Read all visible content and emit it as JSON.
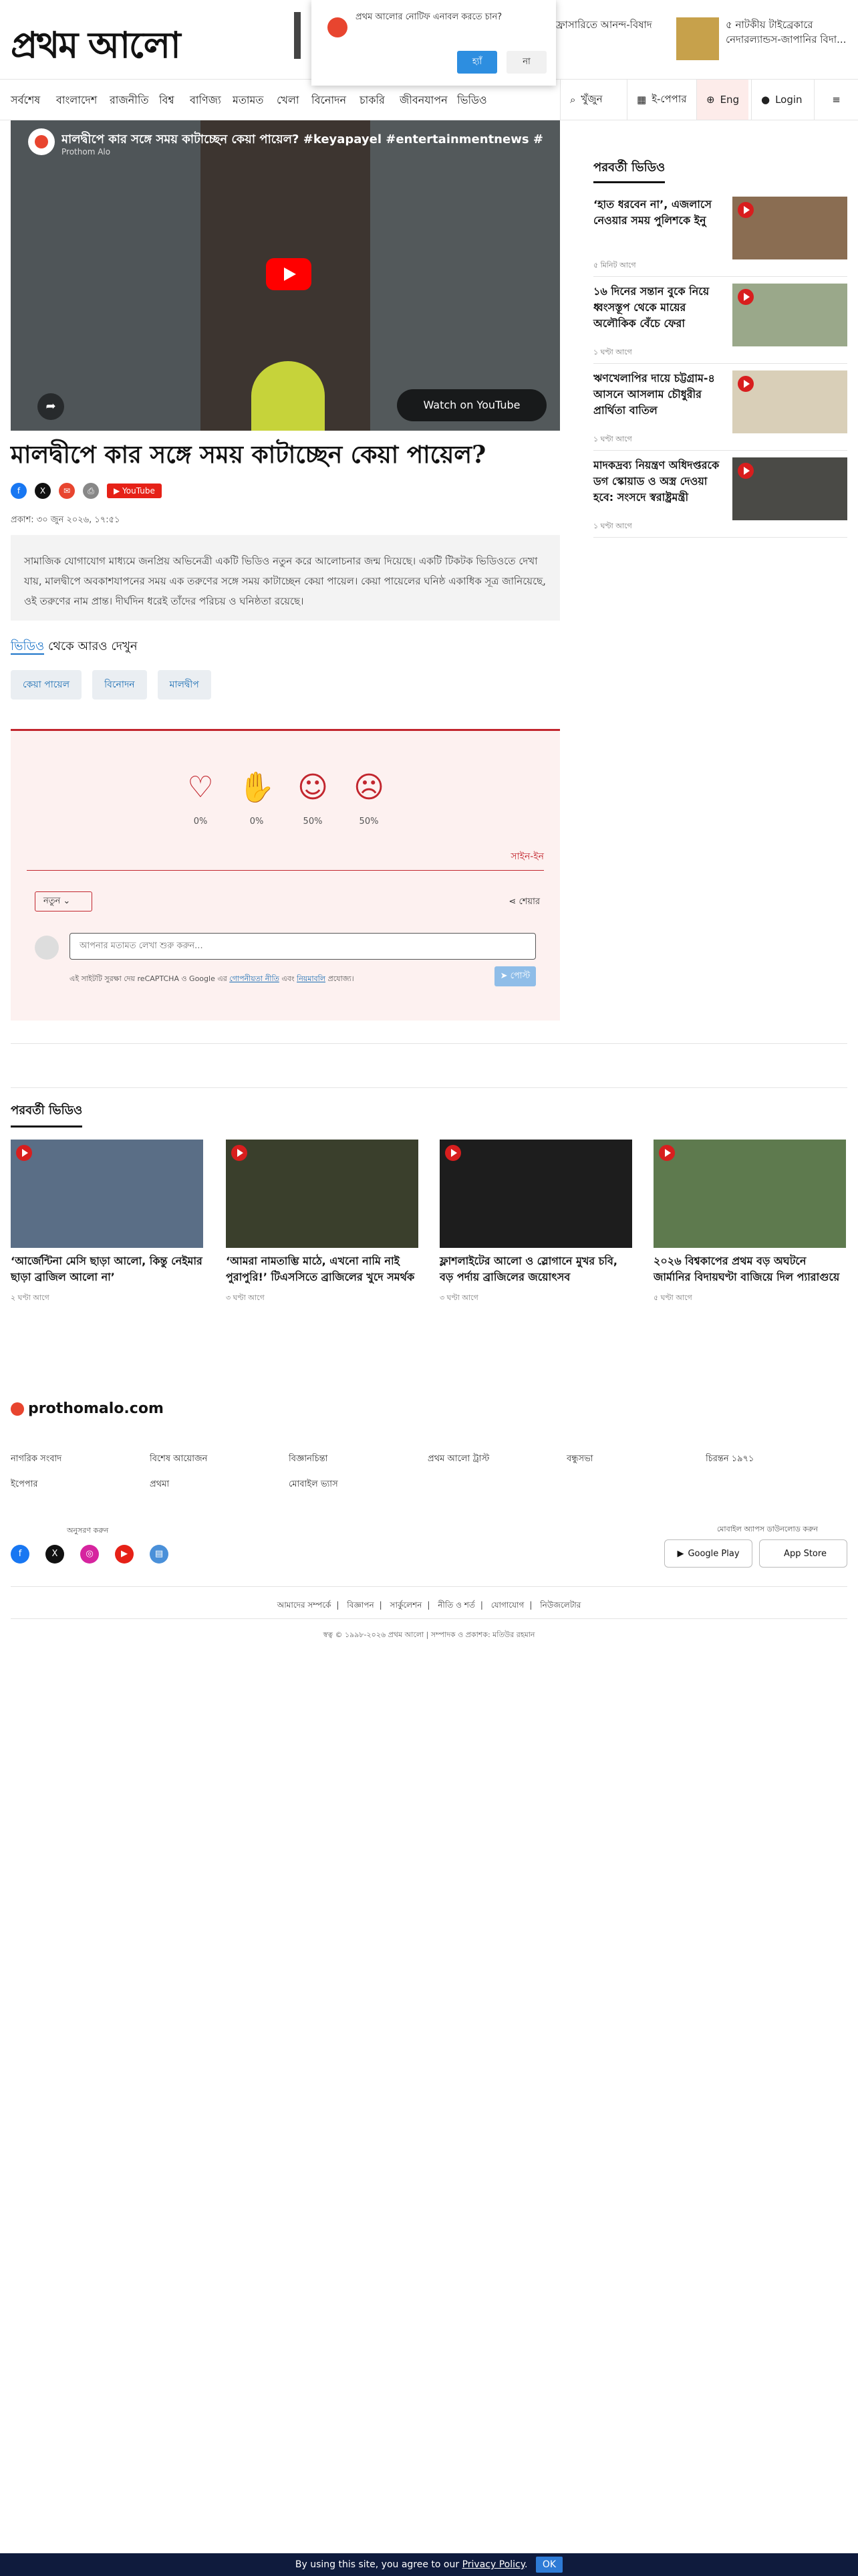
{
  "header": {
    "logo_text": "প্রথম আলো",
    "top_news_1": "ফ্রাসারিতে আনন্দ-বিষাদ",
    "top_news_2_line1": "৫ নাটকীয় টাইব্রেকারে",
    "top_news_2_line2": "নেদারল্যান্ডস-জাপানির বিদা..."
  },
  "notification": {
    "message": "প্রথম আলোর নোটিফ এনাবল করতে চান?",
    "yes": "হ্যাঁ",
    "no": "না"
  },
  "nav": {
    "items": [
      "সর্বশেষ",
      "বাংলাদেশ",
      "রাজনীতি",
      "বিশ্ব",
      "বাণিজ্য",
      "মতামত",
      "খেলা",
      "বিনোদন",
      "চাকরি",
      "জীবনযাপন",
      "ভিডিও"
    ],
    "search": "খুঁজুন",
    "epaper": "ই-পেপার",
    "lang": "Eng",
    "login": "Login"
  },
  "player": {
    "title": "মালদ্বীপে কার সঙ্গে সময় কাটাচ্ছেন কেয়া পায়েল? #keyapayel #entertainmentnews #proth",
    "channel": "Prothom Alo",
    "watch_on": "Watch on YouTube"
  },
  "article": {
    "headline": "মালদ্বীপে কার সঙ্গে সময় কাটাচ্ছেন কেয়া পায়েল?",
    "youtube_badge": "YouTube",
    "published": "প্রকাশ: ৩০ জুন ২০২৬, ১৭:৫১",
    "summary": "সামাজিক যোগাযোগ মাধ্যমে জনপ্রিয় অভিনেত্রী একটি ভিডিও নতুন করে আলোচনার জন্ম দিয়েছে। একটি টিকটক ভিডিওতে দেখা যায়, মালদ্বীপে অবকাশযাপনের সময় এক তরুণের সঙ্গে সময় কাটাচ্ছেন কেয়া পায়েল। কেয়া পায়েলের ঘনিষ্ঠ একাধিক সূত্র জানিয়েছে, ওই তরুণের নাম প্রান্ত। দীর্ঘদিন ধরেই তাঁদের পরিচয় ও ঘনিষ্ঠতা রয়েছে।",
    "more_from_prefix": "ভিডিও",
    "more_from_suffix": " থেকে আরও দেখুন",
    "tags": [
      "কেয়া পায়েল",
      "বিনোদন",
      "মালদ্বীপ"
    ]
  },
  "comments": {
    "reactions": [
      {
        "icon": "heart-icon",
        "glyph": "♡",
        "pct": "0%"
      },
      {
        "icon": "clap-icon",
        "glyph": "✋",
        "pct": "0%"
      },
      {
        "icon": "smile-icon",
        "glyph": "☺",
        "pct": "50%"
      },
      {
        "icon": "sad-icon",
        "glyph": "☹",
        "pct": "50%"
      }
    ],
    "signin": "সাইন-ইন",
    "sort": "নতুন",
    "share": "শেয়ার",
    "placeholder": "আপনার মতামত লেখা শুরু করুন...",
    "captcha_pre": "এই সাইটটি সুরক্ষা দেয় reCAPTCHA ও Google এর ",
    "privacy": "গোপনীয়তা নীতি",
    "and": " এবং ",
    "terms": "নিয়মাবলি",
    "captcha_post": " প্রযোজ্য।",
    "send": "পোস্ট"
  },
  "sidebar": {
    "heading": "পরবর্তী ভিডিও",
    "items": [
      {
        "title": "‘হাত ধরবেন না’, এজলাসে নেওয়ার সময় পুলিশকে ইনু",
        "time": "৫ মিনিট আগে",
        "color": "#8a6d52"
      },
      {
        "title": "১৬ দিনের সন্তান বুকে নিয়ে ধ্বংসস্তূপ থেকে মায়ের অলৌকিক বেঁচে ফেরা",
        "time": "১ ঘণ্টা আগে",
        "color": "#9aa88a"
      },
      {
        "title": "ঋণখেলাপির দায়ে চট্টগ্রাম-৪ আসনে আসলাম চৌধুরীর প্রার্থিতা বাতিল",
        "time": "১ ঘণ্টা আগে",
        "color": "#d9cfb8"
      },
      {
        "title": "মাদকদ্রব্য নিয়ন্ত্রণ অধিদপ্তরকে ডগ স্কোয়াড ও অস্ত্র দেওয়া হবে: সংসদে স্বরাষ্ট্রমন্ত্রী",
        "time": "১ ঘণ্টা আগে",
        "color": "#4a4a46"
      }
    ]
  },
  "next_videos": {
    "heading": "পরবর্তী ভিডিও",
    "items": [
      {
        "title": "‘আর্জেন্টিনা মেসি ছাড়া আলো, কিন্তু নেইমার ছাড়া ব্রাজিল আলো না’",
        "time": "২ ঘণ্টা আগে",
        "color": "#5a6e86"
      },
      {
        "title": "‘আমরা নামতাম্ভি মাঠে, এখনো নামি নাই পুরাপুরি!’ টিএসসিতে ব্রাজিলের খুদে সমর্থক",
        "time": "৩ ঘণ্টা আগে",
        "color": "#3a3f2c"
      },
      {
        "title": "ফ্লাশলাইটের আলো ও স্লোগানে মুখর চবি, বড় পর্দায় ব্রাজিলের জয়োৎসব",
        "time": "৩ ঘণ্টা আগে",
        "color": "#1d1d1d"
      },
      {
        "title": "২০২৬ বিশ্বকাপের প্রথম বড় অঘটনে জার্মানির বিদায়ঘণ্টা বাজিয়ে দিল প্যারাগুয়ে",
        "time": "৫ ঘণ্টা আগে",
        "color": "#5e7a4e"
      }
    ]
  },
  "footer": {
    "logo": "prothomalo.com",
    "links_row1": [
      "নাগরিক সংবাদ",
      "বিশেষ আয়োজন",
      "বিজ্ঞানচিন্তা",
      "প্রথম আলো ট্রাস্ট",
      "বন্ধুসভা",
      "চিরন্তন ১৯৭১"
    ],
    "links_row2": [
      "ইপেপার",
      "প্রথমা",
      "মোবাইল ভ্যাস"
    ],
    "follow": "অনুসরণ করুন",
    "mobile_apps": "মোবাইল অ্যাপস ডাউনলোড করুন",
    "google_play": "Google Play",
    "app_store": "App Store",
    "bottom_links": [
      "আমাদের সম্পর্কে",
      "বিজ্ঞাপন",
      "সার্কুলেশন",
      "নীতি ও শর্ত",
      "যোগাযোগ",
      "নিউজলেটার"
    ],
    "copyright": "স্বত্ব © ১৯৯৮-২০২৬ প্রথম আলো  |  সম্পাদক ও প্রকাশক: মতিউর রহমান"
  },
  "cookie": {
    "text": "By using this site, you agree to our ",
    "policy": "Privacy Policy",
    "ok": "OK"
  }
}
